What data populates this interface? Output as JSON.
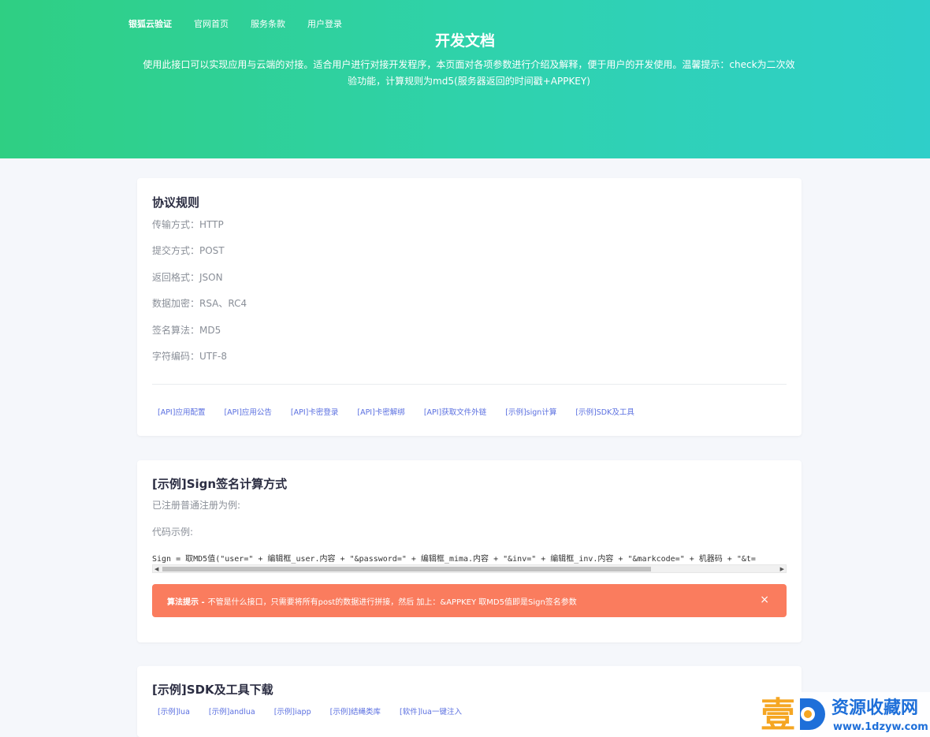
{
  "nav": {
    "brand": "银狐云验证",
    "items": [
      "官网首页",
      "服务条款",
      "用户登录"
    ]
  },
  "hero": {
    "title": "开发文档",
    "desc_line1": "使用此接口可以实现应用与云端的对接。适合用户进行对接开发程序，本页面对各项参数进行介绍及解释，便于用户的开发使用。温馨提示：check为二次效",
    "desc_line2": "验功能，计算规则为md5(服务器返回的时间戳+APPKEY)"
  },
  "protocol": {
    "title": "协议规则",
    "lines": [
      "传输方式：HTTP",
      "提交方式：POST",
      "返回格式：JSON",
      "数据加密：RSA、RC4",
      "签名算法：MD5",
      "字符编码：UTF-8"
    ],
    "links": [
      "[API]应用配置",
      "[API]应用公告",
      "[API]卡密登录",
      "[API]卡密解绑",
      "[API]获取文件外链",
      "[示例]sign计算",
      "[示例]SDK及工具"
    ]
  },
  "sign": {
    "title": "[示例]Sign签名计算方式",
    "subtitle": "已注册普通注册为例:",
    "code_label": "代码示例:",
    "code": "Sign = 取MD5值(\"user=\" + 编辑框_user.内容 + \"&password=\" + 编辑框_mima.内容 + \"&inv=\" + 编辑框_inv.内容 + \"&markcode=\" + 机器码 + \"&t=",
    "alert_bold": "算法提示 -",
    "alert_text": "不管是什么接口，只需要将所有post的数据进行拼接，然后 加上：&APPKEY 取MD5值即是Sign签名参数",
    "close_glyph": "×"
  },
  "sdk": {
    "title": "[示例]SDK及工具下载",
    "links": [
      "[示例]lua",
      "[示例]andlua",
      "[示例]iapp",
      "[示例]结绳类库",
      "[软件]lua一键注入"
    ]
  },
  "watermark": {
    "char": "壹",
    "letter": "D",
    "name": "资源收藏网",
    "url": "www.1dzyw.com"
  },
  "colors": {
    "hero_start": "#2fcf83",
    "hero_end": "#2fcfc9",
    "link": "#5a6fe0",
    "alert": "#fa7c5e"
  }
}
